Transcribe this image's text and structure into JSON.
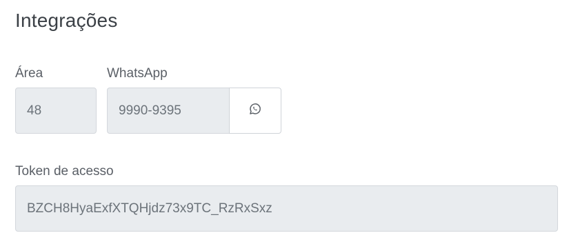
{
  "section": {
    "title": "Integrações"
  },
  "area": {
    "label": "Área",
    "value": "48"
  },
  "whatsapp": {
    "label": "WhatsApp",
    "value": "9990-9395",
    "icon": "whatsapp-icon"
  },
  "token": {
    "label": "Token de acesso",
    "value": "BZCH8HyaExfXTQHjdz73x9TC_RzRxSxz"
  },
  "colors": {
    "field_bg": "#e9ecef",
    "field_border": "#d3d7dc",
    "text": "#4a4f55"
  }
}
